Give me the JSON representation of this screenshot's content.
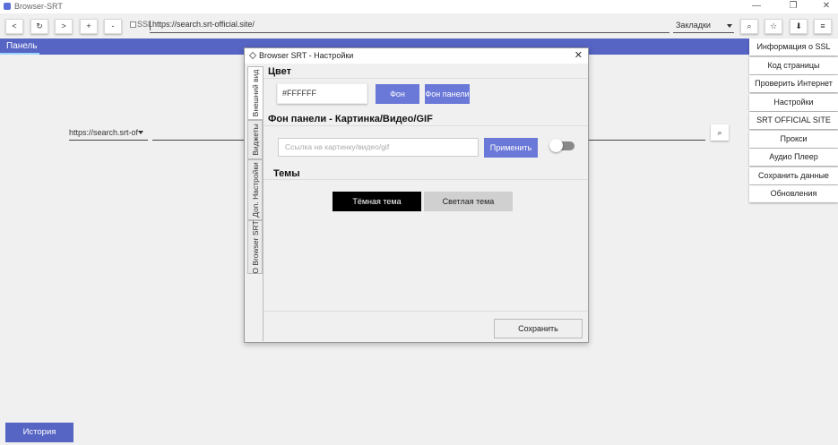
{
  "window": {
    "title": "Browser-SRT",
    "minimize": "—",
    "restore": "❐",
    "close": "✕"
  },
  "toolbar": {
    "back": "<",
    "reload": "↻",
    "forward": ">",
    "zoom_in": "+",
    "zoom_out": "-",
    "ssl_label": "SSL",
    "url": "https://search.srt-official.site/",
    "bookmarks": "Закладки",
    "search_glyph": "⌕",
    "star_glyph": "☆",
    "download_glyph": "⬇",
    "menu_glyph": "≡"
  },
  "panel": {
    "label": "Панель"
  },
  "page": {
    "search_engine": "https://search.srt-of",
    "search_glyph": "⌕"
  },
  "menu": {
    "items": [
      "Информация о SSL",
      "Код страницы",
      "Проверить Интернет",
      "Настройки",
      "SRT OFFICIAL SITE",
      "Прокси",
      "Аудио Плеер",
      "Сохранить данные",
      "Обновления"
    ]
  },
  "history": {
    "label": "История"
  },
  "dialog": {
    "title": "Browser SRT - Настройки",
    "close": "✕",
    "tabs": [
      "Внешний вид",
      "Виджеты",
      "Доп. Настройки",
      "О Browser SRT"
    ],
    "color_section": "Цвет",
    "color_value": "#FFFFFF",
    "bg_button": "Фон",
    "panel_bg_button": "Фон панели",
    "panel_bg_section": "Фон панели - Картинка/Видео/GIF",
    "url_placeholder": "Ссылка на картинку/видео/gif",
    "apply_button": "Применить",
    "toggle_state": false,
    "themes_section": "Темы",
    "dark_theme": "Тёмная тема",
    "light_theme": "Светлая тема",
    "save_button": "Сохранить"
  },
  "colors": {
    "accent": "#5664c4",
    "button_accent": "#6a78d8",
    "dark_theme_bg": "#000000",
    "light_theme_bg": "#d0d0d0"
  }
}
